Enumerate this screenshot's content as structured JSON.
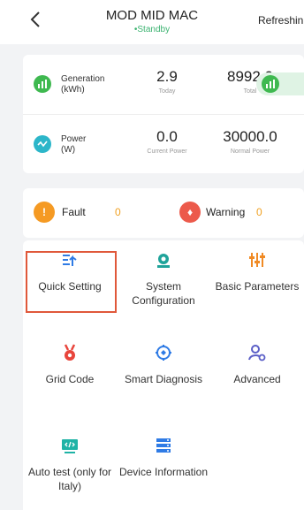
{
  "header": {
    "title": "MOD MID MAC",
    "status": "•Standby",
    "back_icon": "chevron-left-icon",
    "refresh_label": "Refreshin"
  },
  "generation": {
    "label_line1": "Generation",
    "label_line2": "(kWh)",
    "today_value": "2.9",
    "today_label": "Today",
    "total_value": "8992.0",
    "total_label": "Total"
  },
  "power": {
    "label_line1": "Power",
    "label_line2": "(W)",
    "current_value": "0.0",
    "current_label": "Current Power",
    "normal_value": "30000.0",
    "normal_label": "Normal Power"
  },
  "alerts": {
    "fault_label": "Fault",
    "fault_count": "0",
    "warning_label": "Warning",
    "warning_count": "0"
  },
  "functions": [
    {
      "label": "Quick Setting",
      "icon": "quick-setting-icon",
      "selected": true
    },
    {
      "label": "System Configuration",
      "icon": "system-configuration-icon"
    },
    {
      "label": "Basic Parameters",
      "icon": "basic-parameters-icon"
    },
    {
      "label": "Grid Code",
      "icon": "grid-code-icon"
    },
    {
      "label": "Smart Diagnosis",
      "icon": "smart-diagnosis-icon"
    },
    {
      "label": "Advanced",
      "icon": "advanced-icon"
    },
    {
      "label": "Auto test (only for Italy)",
      "icon": "auto-test-icon"
    },
    {
      "label": "Device Information",
      "icon": "device-information-icon"
    }
  ],
  "colors": {
    "accent": "#2f7be5",
    "generation": "#3fb950",
    "power": "#2cb6c9",
    "fault": "#f59a23",
    "warning": "#ec5a4b",
    "selection": "#e0583a",
    "status": "#3cb371"
  }
}
